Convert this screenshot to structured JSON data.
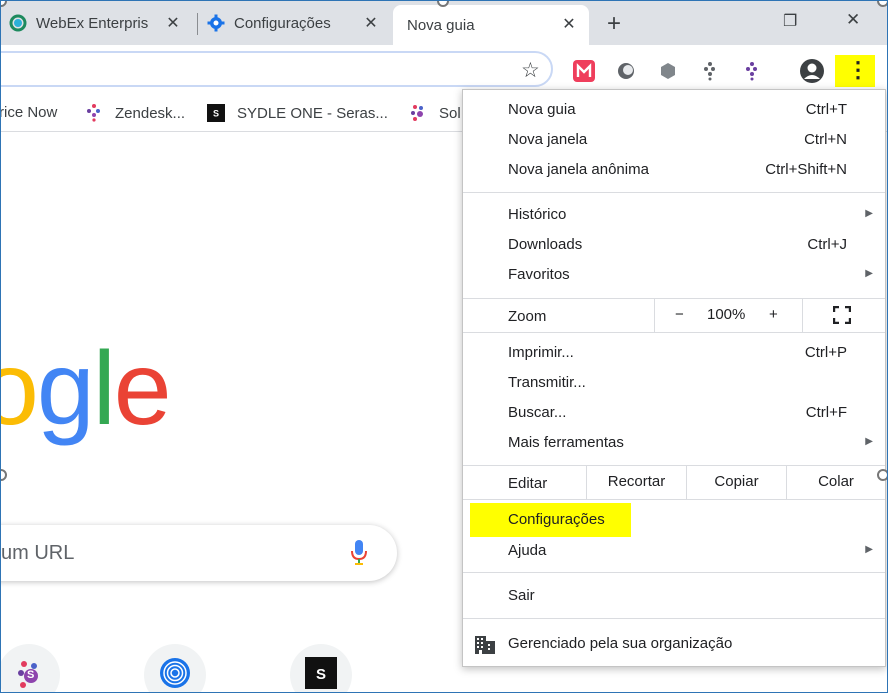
{
  "tabs": [
    {
      "label": "WebEx Enterpris",
      "icon": "webex-icon",
      "active": false
    },
    {
      "label": "Configurações",
      "icon": "gear-icon",
      "active": false
    },
    {
      "label": "Nova guia",
      "icon": "",
      "active": true
    }
  ],
  "new_tab_symbol": "+",
  "window_controls": {
    "minimize": "—",
    "restore": "❐",
    "close": "✕"
  },
  "toolbar": {
    "star_symbol": "☆",
    "menu_symbol": "⋮"
  },
  "bookmarks": [
    {
      "label": "rice Now",
      "icon": ""
    },
    {
      "label": "Zendesk...",
      "icon": "zendesk-dots-icon"
    },
    {
      "label": "SYDLE ONE - Seras...",
      "icon": "sydle-icon"
    },
    {
      "label": "Sol",
      "icon": "sydle-dots-icon"
    }
  ],
  "page": {
    "logo_letters": [
      "o",
      "g",
      "l",
      "e"
    ],
    "search_placeholder": "um URL",
    "shortcut_s": "S"
  },
  "menu": {
    "items_top": [
      {
        "label": "Nova guia",
        "shortcut": "Ctrl+T"
      },
      {
        "label": "Nova janela",
        "shortcut": "Ctrl+N"
      },
      {
        "label": "Nova janela anônima",
        "shortcut": "Ctrl+Shift+N"
      }
    ],
    "items_history": [
      {
        "label": "Histórico",
        "shortcut": "",
        "submenu": true
      },
      {
        "label": "Downloads",
        "shortcut": "Ctrl+J",
        "submenu": false
      },
      {
        "label": "Favoritos",
        "shortcut": "",
        "submenu": true
      }
    ],
    "zoom": {
      "label": "Zoom",
      "minus": "−",
      "value": "100%",
      "plus": "+"
    },
    "items_tools": [
      {
        "label": "Imprimir...",
        "shortcut": "Ctrl+P",
        "submenu": false
      },
      {
        "label": "Transmitir...",
        "shortcut": "",
        "submenu": false
      },
      {
        "label": "Buscar...",
        "shortcut": "Ctrl+F",
        "submenu": false
      },
      {
        "label": "Mais ferramentas",
        "shortcut": "",
        "submenu": true
      }
    ],
    "edit": {
      "label": "Editar",
      "cut": "Recortar",
      "copy": "Copiar",
      "paste": "Colar"
    },
    "settings": "Configurações",
    "help": "Ajuda",
    "exit": "Sair",
    "managed": "Gerenciado pela sua organização"
  },
  "colors": {
    "highlight": "#ffff00",
    "google_blue": "#4285f4",
    "google_red": "#ea4335",
    "google_yellow": "#fbbc05",
    "google_green": "#34a853"
  }
}
